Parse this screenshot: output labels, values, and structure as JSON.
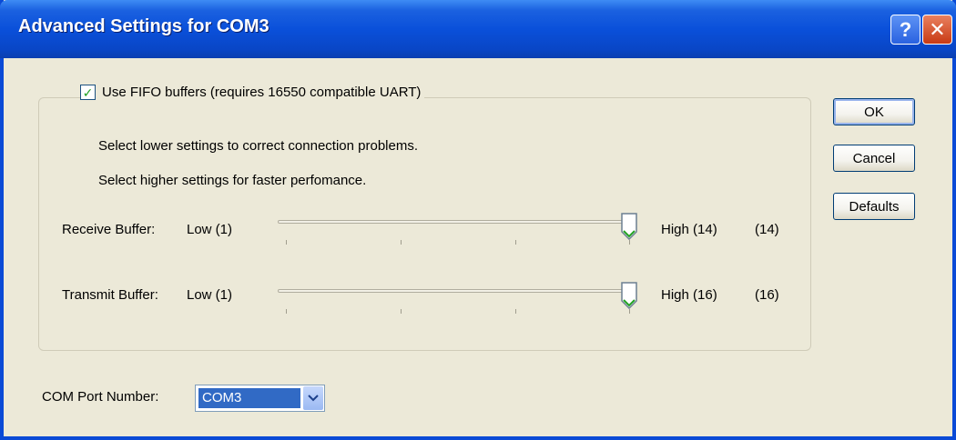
{
  "window": {
    "title": "Advanced Settings for COM3",
    "help_label": "?",
    "close_label": "✕"
  },
  "fifo": {
    "checked": true,
    "checkbox_mark": "✓",
    "label": "Use FIFO buffers (requires 16550 compatible UART)",
    "hint1": "Select lower settings to correct connection problems.",
    "hint2": "Select higher settings for faster perfomance."
  },
  "receive": {
    "label": "Receive Buffer:",
    "low": "Low (1)",
    "high": "High (14)",
    "value_text": "(14)",
    "level": 1.0
  },
  "transmit": {
    "label": "Transmit Buffer:",
    "low": "Low (1)",
    "high": "High (16)",
    "value_text": "(16)",
    "level": 1.0
  },
  "buttons": {
    "ok": "OK",
    "cancel": "Cancel",
    "defaults": "Defaults"
  },
  "com_port": {
    "label": "COM Port Number:",
    "value": "COM3"
  },
  "colors": {
    "titlebar": "#0a50da",
    "dialog_bg": "#ece9d8",
    "thumb_accent": "#21a121",
    "selection": "#316ac5"
  }
}
